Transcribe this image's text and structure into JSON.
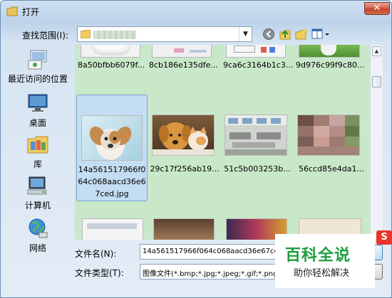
{
  "window": {
    "title": "打开",
    "close_label": "✕"
  },
  "toolbar": {
    "lookin_label": "查找范围(I):",
    "lookin_arrow": "▼"
  },
  "places": [
    {
      "label": "最近访问的位置",
      "icon": "recent-places-icon"
    },
    {
      "label": "桌面",
      "icon": "desktop-icon"
    },
    {
      "label": "库",
      "icon": "libraries-icon"
    },
    {
      "label": "计算机",
      "icon": "computer-icon"
    },
    {
      "label": "网络",
      "icon": "network-icon"
    }
  ],
  "files": {
    "row1": [
      {
        "caption": "8a50bfbb6079f..."
      },
      {
        "caption": "8cb186e135dfe..."
      },
      {
        "caption": "9ca6c3164b1c3..."
      },
      {
        "caption": "9d976c99f9c80..."
      }
    ],
    "row2": [
      {
        "caption_lines": [
          "14a561517966f0",
          "64c068aacd36e6",
          "7ced.jpg"
        ],
        "selected": true
      },
      {
        "caption": "29c17f256ab19..."
      },
      {
        "caption": "51c5b003253b..."
      },
      {
        "caption": "56ccd85e4da1..."
      }
    ]
  },
  "form": {
    "filename_label": "文件名(N):",
    "filename_value": "14a561517966f064c068aacd36e67ced.jpg",
    "filetype_label": "文件类型(T):",
    "filetype_value": "图像文件(*.bmp;*.jpg;*.jpeg;*.gif;*.png)"
  },
  "watermark": {
    "title": "百科全说",
    "subtitle": "助你轻松解决",
    "logo_letter": "S"
  },
  "colors": {
    "file_area_bg": "#c9e8c9",
    "selection_bg": "#c4ddf3",
    "close_red": "#c2432a",
    "watermark_green": "#1d9e3f"
  }
}
